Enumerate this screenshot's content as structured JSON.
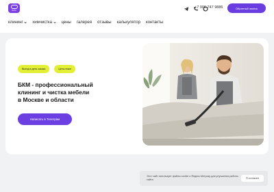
{
  "header": {
    "logo_text": "БКМ",
    "phone": "+7 906 747 9886",
    "callback_label": "Обратный звонок",
    "social_icons": [
      "telegram-icon",
      "phone-call-icon",
      "chat-icon"
    ]
  },
  "nav": {
    "items": [
      {
        "label": "клининг",
        "has_dropdown": true
      },
      {
        "label": "химчистка",
        "has_dropdown": true
      },
      {
        "label": "цены",
        "has_dropdown": false
      },
      {
        "label": "галерея",
        "has_dropdown": false
      },
      {
        "label": "отзывы",
        "has_dropdown": false
      },
      {
        "label": "калькулятор",
        "has_dropdown": false
      },
      {
        "label": "контакты",
        "has_dropdown": false
      }
    ]
  },
  "hero": {
    "tags": [
      "Выезд в день заказа",
      "Цены ниже"
    ],
    "title_lines": [
      "БКМ - профессиональный",
      "клининг и чистка мебели",
      "в Москве и области"
    ],
    "cta_label": "Написать в Телеграм"
  },
  "cookie": {
    "text": "Этот сайт использует файлы cookie и Яндекс.Метрику для улучшения работы сайта",
    "accept_label": "Я согласен"
  },
  "colors": {
    "accent": "#6b3fe2",
    "tag": "#e3ef34",
    "page_bg": "#f1f2f4"
  }
}
